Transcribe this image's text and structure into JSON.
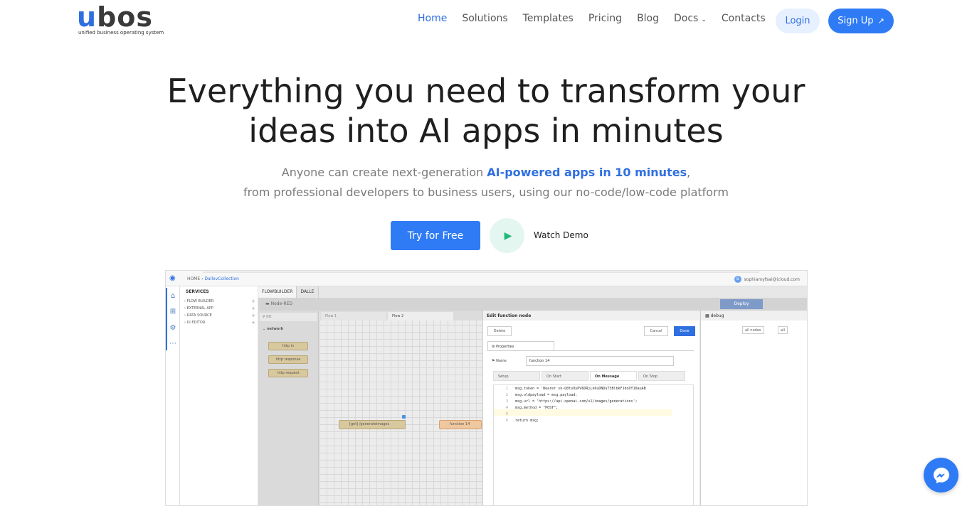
{
  "brand": {
    "name_accent": "u",
    "name_rest": "bos",
    "tagline": "unified business operating system"
  },
  "nav": {
    "items": [
      {
        "label": "Home",
        "active": true
      },
      {
        "label": "Solutions"
      },
      {
        "label": "Templates"
      },
      {
        "label": "Pricing"
      },
      {
        "label": "Blog"
      },
      {
        "label": "Docs",
        "dropdown": true
      },
      {
        "label": "Contacts"
      }
    ],
    "login_label": "Login",
    "signup_label": "Sign Up"
  },
  "hero": {
    "title_line1": "Everything you need to transform your",
    "title_line2": "ideas into AI apps in minutes",
    "sub_pre": "Anyone can create next-generation ",
    "sub_highlight": "AI-powered apps in 10 minutes",
    "sub_post": ",",
    "sub_line2": "from professional developers to business users, using our no-code/low-code platform",
    "try_label": "Try for Free",
    "watch_label": "Watch Demo"
  },
  "app_preview": {
    "breadcrumb_home": "HOME",
    "breadcrumb_sep": " › ",
    "breadcrumb_current": "DallevCollection",
    "user_initial": "S",
    "user_email": "sophiamyfsai@icloud.com",
    "services_title": "SERVICES",
    "services": [
      "FLOW BUILDER",
      "EXTERNAL APP",
      "DATA SOURCE",
      "UI EDITOR"
    ],
    "main_tabs": [
      "FLOWBUILDER",
      "DALLE"
    ],
    "nodered_title": "Node-RED",
    "deploy_label": "Deploy",
    "palette_search": "htt",
    "palette_category": "network",
    "palette_nodes": [
      "http in",
      "http response",
      "http request"
    ],
    "flow_tabs": [
      "Flow 1",
      "Flow 2"
    ],
    "canvas_nodes": {
      "get": "[get] /generateimages",
      "func": "function 14"
    },
    "edit_title": "Edit function node",
    "delete_label": "Delete",
    "cancel_label": "Cancel",
    "done_label": "Done",
    "properties_label": "Properties",
    "name_label": "Name",
    "name_value": "function 14",
    "subtabs": [
      "Setup",
      "On Start",
      "On Message",
      "On Stop"
    ],
    "code": [
      "msg.token = 'Bearer sk-Q0tvOyPV6DRjLk6uDNDuT3BlbkFJdoOY10auAB",
      "msg.oldpayload = msg.payload;",
      "msg.url = 'https://api.openai.com/v1/images/generations';",
      "msg.method = \"POST\";",
      "",
      "return msg;"
    ],
    "debug_label": "debug",
    "debug_filter_nodes": "all nodes",
    "debug_filter_all": "all"
  },
  "colors": {
    "accent": "#2f7bf5",
    "accent_text": "#2f6fe0",
    "demo_green": "#20b87a"
  }
}
